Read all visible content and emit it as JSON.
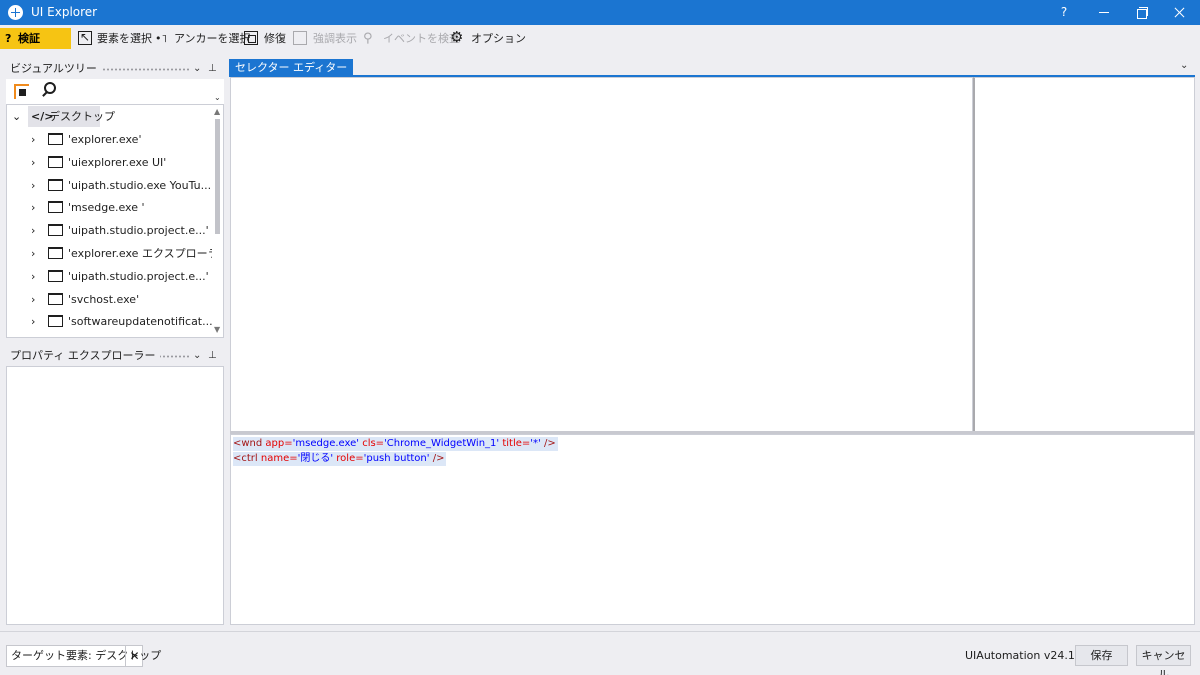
{
  "window": {
    "title": "UI Explorer",
    "help_label": "?"
  },
  "toolbar": {
    "validate_q": "?",
    "validate_label": "検証",
    "select_element_label": "要素を選択",
    "select_anchor_label": "アンカーを選択",
    "select_anchor_icon": "•˥",
    "repair_label": "修復",
    "highlight_label": "強調表示",
    "inspect_events_label": "イベントを検査",
    "options_label": "オプション"
  },
  "visual_tree": {
    "title": "ビジュアルツリー",
    "root_label": "デスクトップ",
    "root_icon": "</>",
    "items": [
      {
        "label": "'explorer.exe'"
      },
      {
        "label": "'uiexplorer.exe UI'"
      },
      {
        "label": "'uipath.studio.exe YouTu...'"
      },
      {
        "label": "'msedge.exe '"
      },
      {
        "label": "'uipath.studio.project.e...'"
      },
      {
        "label": "'explorer.exe  エクスプローラー'"
      },
      {
        "label": "'uipath.studio.project.e...'"
      },
      {
        "label": "'svchost.exe'"
      },
      {
        "label": "'softwareupdatenotificat...'"
      }
    ]
  },
  "property_explorer": {
    "title": "プロパティ エクスプローラー"
  },
  "selector_editor": {
    "tab_label": "セレクター エディター",
    "line1": {
      "tag_open": "<wnd",
      "a1": " app=",
      "v1": "'msedge.exe'",
      "a2": " cls=",
      "v2": "'Chrome_WidgetWin_1'",
      "a3": " title=",
      "v3": "'*'",
      "tag_close": " />"
    },
    "line2": {
      "tag_open": "<ctrl",
      "a1": " name=",
      "v1": "'閉じる'",
      "a2": " role=",
      "v2": "'push button'",
      "tag_close": " />"
    }
  },
  "status": {
    "target_element": "ターゲット要素: デスクトップ",
    "clear_icon": "✕",
    "version": "UIAutomation v24.12.1",
    "save_label": "保存",
    "cancel_label": "キャンセル"
  },
  "colors": {
    "accent": "#1b75d1",
    "validate_bg": "#f6c413",
    "highlight_target": "#f08b1d",
    "background": "#eeeef2"
  }
}
